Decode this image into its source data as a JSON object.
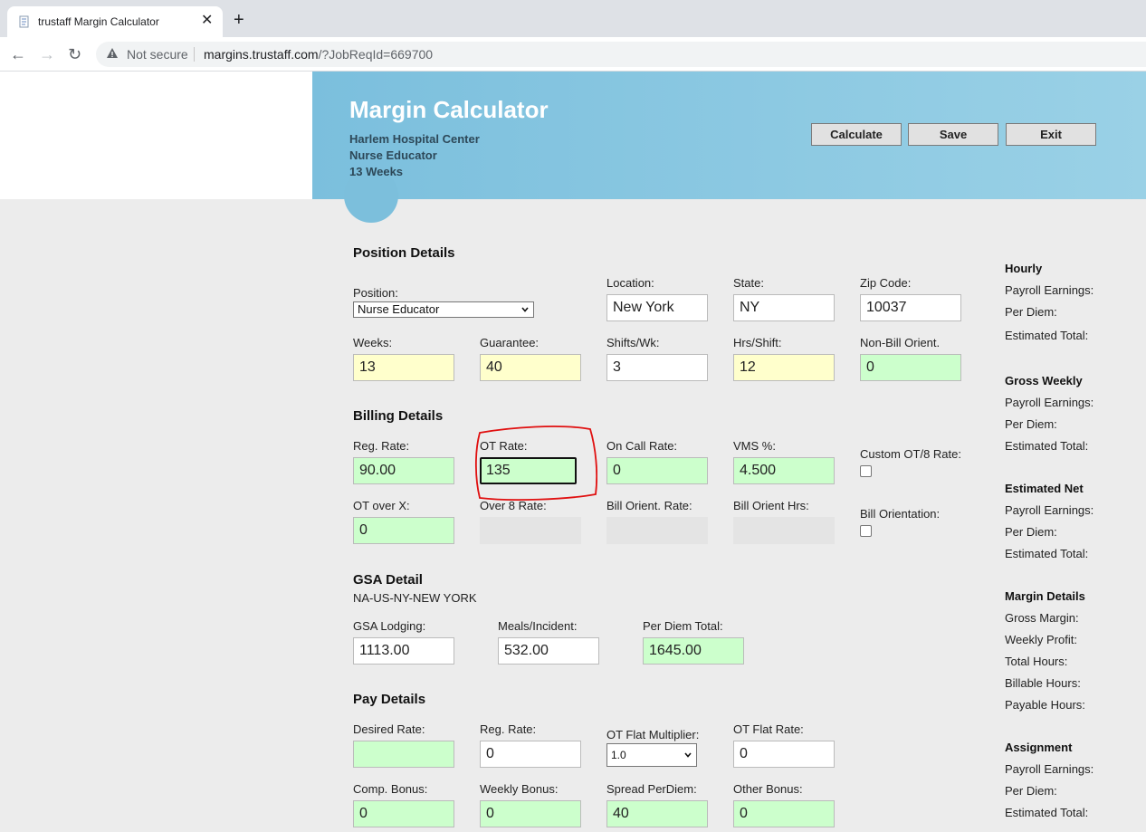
{
  "browser": {
    "tab_title": "trustaff Margin Calculator",
    "security_label": "Not secure",
    "url_domain": "margins.trustaff.com",
    "url_path": "/?JobReqId=669700"
  },
  "header": {
    "title": "Margin Calculator",
    "facility": "Harlem Hospital Center",
    "position": "Nurse Educator",
    "duration": "13 Weeks",
    "calculate_label": "Calculate",
    "save_label": "Save",
    "exit_label": "Exit"
  },
  "position_details": {
    "heading": "Position Details",
    "position_label": "Position:",
    "position_value": "Nurse Educator",
    "location_label": "Location:",
    "location_value": "New York",
    "state_label": "State:",
    "state_value": "NY",
    "zip_label": "Zip Code:",
    "zip_value": "10037",
    "weeks_label": "Weeks:",
    "weeks_value": "13",
    "guarantee_label": "Guarantee:",
    "guarantee_value": "40",
    "shifts_label": "Shifts/Wk:",
    "shifts_value": "3",
    "hrs_label": "Hrs/Shift:",
    "hrs_value": "12",
    "nonbill_label": "Non-Bill Orient.",
    "nonbill_value": "0"
  },
  "billing_details": {
    "heading": "Billing Details",
    "reg_rate_label": "Reg. Rate:",
    "reg_rate_value": "90.00",
    "ot_rate_label": "OT Rate:",
    "ot_rate_value": "135",
    "oncall_label": "On Call Rate:",
    "oncall_value": "0",
    "vms_label": "VMS %:",
    "vms_value": "4.500",
    "custom_ot_label": "Custom OT/8 Rate:",
    "ot_over_label": "OT over X:",
    "ot_over_value": "0",
    "over8_label": "Over 8 Rate:",
    "bill_orient_rate_label": "Bill Orient. Rate:",
    "bill_orient_hrs_label": "Bill Orient Hrs:",
    "bill_orientation_label": "Bill Orientation:"
  },
  "gsa_detail": {
    "heading": "GSA Detail",
    "region": "NA-US-NY-NEW YORK",
    "lodging_label": "GSA Lodging:",
    "lodging_value": "1113.00",
    "meals_label": "Meals/Incident:",
    "meals_value": "532.00",
    "perdiem_label": "Per Diem Total:",
    "perdiem_value": "1645.00"
  },
  "pay_details": {
    "heading": "Pay Details",
    "desired_label": "Desired Rate:",
    "desired_value": "",
    "reg_rate_label": "Reg. Rate:",
    "reg_rate_value": "0",
    "ot_mult_label": "OT Flat Multiplier:",
    "ot_mult_value": "1.0",
    "ot_flat_label": "OT Flat Rate:",
    "ot_flat_value": "0",
    "comp_label": "Comp. Bonus:",
    "comp_value": "0",
    "weekly_label": "Weekly Bonus:",
    "weekly_value": "0",
    "spread_label": "Spread PerDiem:",
    "spread_value": "40",
    "other_label": "Other Bonus:",
    "other_value": "0"
  },
  "sidebar": {
    "hourly": "Hourly",
    "gross_weekly": "Gross Weekly",
    "estimated_net": "Estimated Net",
    "margin_details": "Margin Details",
    "assignment": "Assignment",
    "payroll_earnings": "Payroll Earnings:",
    "per_diem": "Per Diem:",
    "estimated_total": "Estimated Total:",
    "gross_margin": "Gross Margin:",
    "weekly_profit": "Weekly Profit:",
    "total_hours": "Total Hours:",
    "billable_hours": "Billable Hours:",
    "payable_hours": "Payable Hours:"
  },
  "colors": {
    "banner": "#7bbfdd",
    "required_yellow": "#ffffcc",
    "editable_green": "#ccffcc",
    "disabled_gray": "#e4e4e4",
    "annotation_red": "#e01010"
  }
}
